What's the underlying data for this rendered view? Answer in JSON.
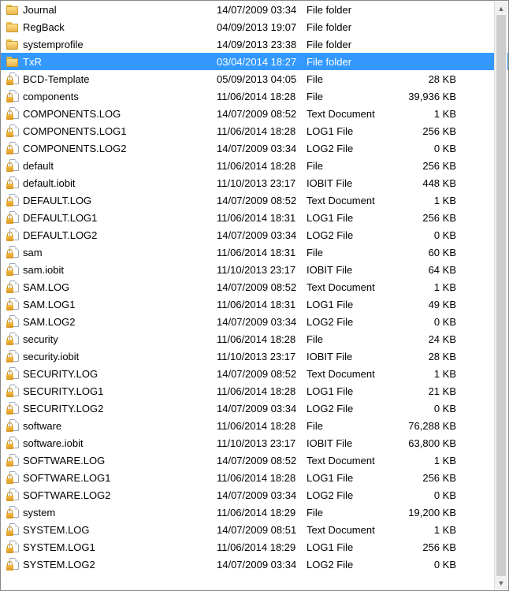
{
  "files": [
    {
      "name": "Journal",
      "date": "14/07/2009 03:34",
      "type": "File folder",
      "size": "",
      "icon": "folder",
      "selected": false
    },
    {
      "name": "RegBack",
      "date": "04/09/2013 19:07",
      "type": "File folder",
      "size": "",
      "icon": "folder",
      "selected": false
    },
    {
      "name": "systemprofile",
      "date": "14/09/2013 23:38",
      "type": "File folder",
      "size": "",
      "icon": "folder",
      "selected": false
    },
    {
      "name": "TxR",
      "date": "03/04/2014 18:27",
      "type": "File folder",
      "size": "",
      "icon": "folder",
      "selected": true
    },
    {
      "name": "BCD-Template",
      "date": "05/09/2013 04:05",
      "type": "File",
      "size": "28 KB",
      "icon": "lockfile",
      "selected": false
    },
    {
      "name": "components",
      "date": "11/06/2014 18:28",
      "type": "File",
      "size": "39,936 KB",
      "icon": "lockfile",
      "selected": false
    },
    {
      "name": "COMPONENTS.LOG",
      "date": "14/07/2009 08:52",
      "type": "Text Document",
      "size": "1 KB",
      "icon": "lockfile",
      "selected": false
    },
    {
      "name": "COMPONENTS.LOG1",
      "date": "11/06/2014 18:28",
      "type": "LOG1 File",
      "size": "256 KB",
      "icon": "lockfile",
      "selected": false
    },
    {
      "name": "COMPONENTS.LOG2",
      "date": "14/07/2009 03:34",
      "type": "LOG2 File",
      "size": "0 KB",
      "icon": "lockfile",
      "selected": false
    },
    {
      "name": "default",
      "date": "11/06/2014 18:28",
      "type": "File",
      "size": "256 KB",
      "icon": "lockfile",
      "selected": false
    },
    {
      "name": "default.iobit",
      "date": "11/10/2013 23:17",
      "type": "IOBIT File",
      "size": "448 KB",
      "icon": "lockfile",
      "selected": false
    },
    {
      "name": "DEFAULT.LOG",
      "date": "14/07/2009 08:52",
      "type": "Text Document",
      "size": "1 KB",
      "icon": "lockfile",
      "selected": false
    },
    {
      "name": "DEFAULT.LOG1",
      "date": "11/06/2014 18:31",
      "type": "LOG1 File",
      "size": "256 KB",
      "icon": "lockfile",
      "selected": false
    },
    {
      "name": "DEFAULT.LOG2",
      "date": "14/07/2009 03:34",
      "type": "LOG2 File",
      "size": "0 KB",
      "icon": "lockfile",
      "selected": false
    },
    {
      "name": "sam",
      "date": "11/06/2014 18:31",
      "type": "File",
      "size": "60 KB",
      "icon": "lockfile",
      "selected": false
    },
    {
      "name": "sam.iobit",
      "date": "11/10/2013 23:17",
      "type": "IOBIT File",
      "size": "64 KB",
      "icon": "lockfile",
      "selected": false
    },
    {
      "name": "SAM.LOG",
      "date": "14/07/2009 08:52",
      "type": "Text Document",
      "size": "1 KB",
      "icon": "lockfile",
      "selected": false
    },
    {
      "name": "SAM.LOG1",
      "date": "11/06/2014 18:31",
      "type": "LOG1 File",
      "size": "49 KB",
      "icon": "lockfile",
      "selected": false
    },
    {
      "name": "SAM.LOG2",
      "date": "14/07/2009 03:34",
      "type": "LOG2 File",
      "size": "0 KB",
      "icon": "lockfile",
      "selected": false
    },
    {
      "name": "security",
      "date": "11/06/2014 18:28",
      "type": "File",
      "size": "24 KB",
      "icon": "lockfile",
      "selected": false
    },
    {
      "name": "security.iobit",
      "date": "11/10/2013 23:17",
      "type": "IOBIT File",
      "size": "28 KB",
      "icon": "lockfile",
      "selected": false
    },
    {
      "name": "SECURITY.LOG",
      "date": "14/07/2009 08:52",
      "type": "Text Document",
      "size": "1 KB",
      "icon": "lockfile",
      "selected": false
    },
    {
      "name": "SECURITY.LOG1",
      "date": "11/06/2014 18:28",
      "type": "LOG1 File",
      "size": "21 KB",
      "icon": "lockfile",
      "selected": false
    },
    {
      "name": "SECURITY.LOG2",
      "date": "14/07/2009 03:34",
      "type": "LOG2 File",
      "size": "0 KB",
      "icon": "lockfile",
      "selected": false
    },
    {
      "name": "software",
      "date": "11/06/2014 18:28",
      "type": "File",
      "size": "76,288 KB",
      "icon": "lockfile",
      "selected": false
    },
    {
      "name": "software.iobit",
      "date": "11/10/2013 23:17",
      "type": "IOBIT File",
      "size": "63,800 KB",
      "icon": "lockfile",
      "selected": false
    },
    {
      "name": "SOFTWARE.LOG",
      "date": "14/07/2009 08:52",
      "type": "Text Document",
      "size": "1 KB",
      "icon": "lockfile",
      "selected": false
    },
    {
      "name": "SOFTWARE.LOG1",
      "date": "11/06/2014 18:28",
      "type": "LOG1 File",
      "size": "256 KB",
      "icon": "lockfile",
      "selected": false
    },
    {
      "name": "SOFTWARE.LOG2",
      "date": "14/07/2009 03:34",
      "type": "LOG2 File",
      "size": "0 KB",
      "icon": "lockfile",
      "selected": false
    },
    {
      "name": "system",
      "date": "11/06/2014 18:29",
      "type": "File",
      "size": "19,200 KB",
      "icon": "lockfile",
      "selected": false
    },
    {
      "name": "SYSTEM.LOG",
      "date": "14/07/2009 08:51",
      "type": "Text Document",
      "size": "1 KB",
      "icon": "lockfile",
      "selected": false
    },
    {
      "name": "SYSTEM.LOG1",
      "date": "11/06/2014 18:29",
      "type": "LOG1 File",
      "size": "256 KB",
      "icon": "lockfile",
      "selected": false
    },
    {
      "name": "SYSTEM.LOG2",
      "date": "14/07/2009 03:34",
      "type": "LOG2 File",
      "size": "0 KB",
      "icon": "lockfile",
      "selected": false
    }
  ]
}
